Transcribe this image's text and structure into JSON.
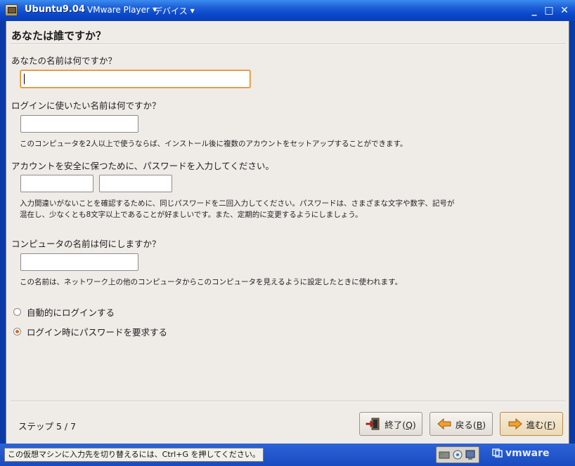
{
  "window": {
    "title": "Ubuntu9.04",
    "menu_player": "VMware Player",
    "menu_devices": "デバイス",
    "menu_arrow": "▼",
    "minimize": "_",
    "maximize": "□",
    "close": "✕"
  },
  "page": {
    "title": "あなたは誰ですか？"
  },
  "form": {
    "name_question": "あなたの名前は何ですか？",
    "name_value": "",
    "login_question": "ログインに使いたい名前は何ですか？",
    "login_value": "",
    "login_hint": "このコンピュータを2人以上で使うならば、インストール後に複数のアカウントをセットアップすることができます。",
    "password_question": "アカウントを安全に保つために、パスワードを入力してください。",
    "password_value": "",
    "password_confirm_value": "",
    "password_hint_line1": "入力間違いがないことを確認するために、同じパスワードを二回入力してください。パスワードは、さまざまな文字や数字、記号が",
    "password_hint_line2": "混在し、少なくとも8文字以上であることが好ましいです。また、定期的に変更するようにしましょう。",
    "computer_question": "コンピュータの名前は何にしますか？",
    "computer_value": "",
    "computer_hint": "この名前は、ネットワーク上の他のコンピュータからこのコンピュータを見えるように設定したときに使われます。",
    "radio_auto_login": "自動的にログインする",
    "radio_require_password": "ログイン時にパスワードを要求する",
    "selected_option": "radio_require_password"
  },
  "footer": {
    "step": "ステップ 5 / 7",
    "quit_label": "終了(",
    "quit_key": "Q",
    "back_label": "戻る(",
    "back_key": "B",
    "forward_label": "進む(",
    "forward_key": "F",
    "close_paren": ")"
  },
  "statusbar": {
    "message": "この仮想マシンに入力先を切り替えるには、Ctrl+G を押してください。",
    "brand": "vmware"
  },
  "colors": {
    "titlebar": "#0a46c9",
    "guest_bg": "#efebe7",
    "focus_border": "#e0862a",
    "radio_dot": "#d5691f"
  },
  "icons": [
    "vm-app-icon",
    "quit-door-icon",
    "back-arrow-icon",
    "forward-arrow-icon",
    "device-tray-icons"
  ]
}
